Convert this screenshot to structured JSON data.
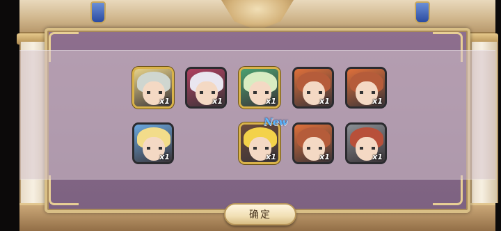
{
  "rewards": [
    {
      "count": "x1",
      "frame": "gold",
      "hair": "#cfd6d0",
      "accent": "#e8d38a"
    },
    {
      "count": "x1",
      "frame": "dark",
      "hair": "#e9e6f0",
      "accent": "#b04060"
    },
    {
      "count": "x1",
      "frame": "gold",
      "hair": "#d8ecc2",
      "accent": "#4aa070"
    },
    {
      "count": "x1",
      "frame": "dark",
      "hair": "#b55c3a",
      "accent": "#e0703a"
    },
    {
      "count": "x1",
      "frame": "dark",
      "hair": "#b55c3a",
      "accent": "#e0703a"
    },
    {
      "count": "x1",
      "frame": "dark",
      "hair": "#f2dc8a",
      "accent": "#6aa8e0"
    },
    {
      "count": "x1",
      "frame": "gold",
      "hair": "#f3d24a",
      "accent": "#6b4a3a",
      "badge": "New"
    },
    {
      "count": "x1",
      "frame": "dark",
      "hair": "#b55c3a",
      "accent": "#e0703a"
    },
    {
      "count": "x1",
      "frame": "dark",
      "hair": "#b8503a",
      "accent": "#8a8f94"
    }
  ],
  "confirm_label": "确定"
}
